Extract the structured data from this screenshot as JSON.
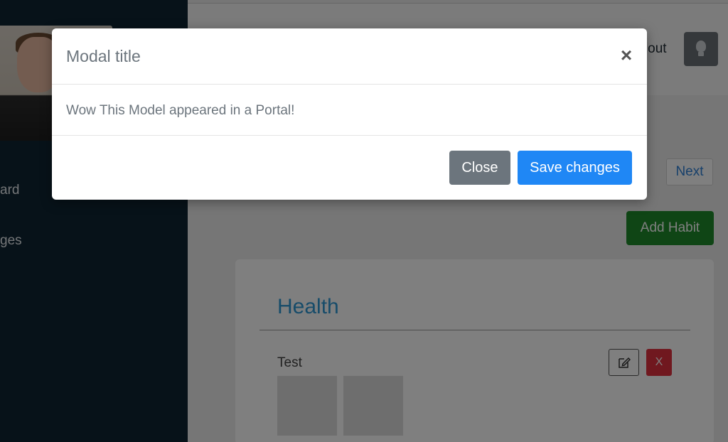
{
  "sidebar": {
    "items": [
      {
        "label": "ard"
      },
      {
        "label": "ges"
      }
    ]
  },
  "header": {
    "logout_label": "ogout",
    "theme_icon": "lightbulb-icon"
  },
  "main": {
    "next_label": "Next",
    "add_habit_label": "Add Habit",
    "card": {
      "title": "Health",
      "habit_name": "Test",
      "delete_label": "X",
      "edit_icon": "edit-icon"
    }
  },
  "modal": {
    "title": "Modal title",
    "close_symbol": "×",
    "body": "Wow This Model appeared in a Portal!",
    "close_label": "Close",
    "save_label": "Save changes"
  },
  "colors": {
    "sidebar_bg": "#0e2433",
    "primary": "#1f87f5",
    "secondary": "#6c757d",
    "success": "#1e8a2a",
    "danger": "#e0303f",
    "card_title": "#2f98d5"
  }
}
